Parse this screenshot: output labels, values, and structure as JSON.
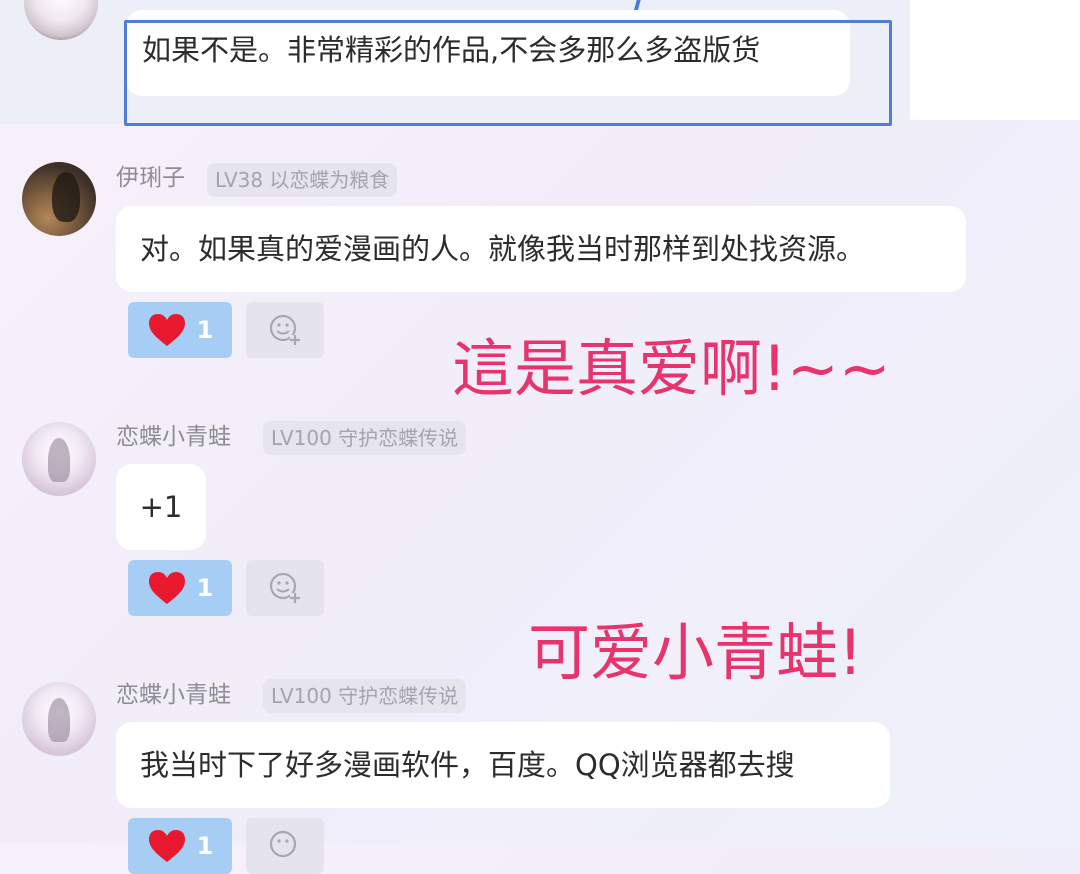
{
  "comments": [
    {
      "text": "如果不是。非常精彩的作品,不会多那么多盗版货"
    },
    {
      "username": "伊琍子",
      "level_badge": "LV38 以恋蝶为粮食",
      "text": "对。如果真的爱漫画的人。就像我当时那样到处找资源。",
      "likes": "1"
    },
    {
      "username": "恋蝶小青蛙",
      "level_badge": "LV100 守护恋蝶传说",
      "text": "+1",
      "likes": "1"
    },
    {
      "username": "恋蝶小青蛙",
      "level_badge": "LV100 守护恋蝶传说",
      "text": "我当时下了好多漫画软件，百度。QQ浏览器都去搜",
      "likes": "1"
    }
  ],
  "annotations": {
    "first": "這是真爱啊!~~",
    "second": "可爱小青蛙!"
  },
  "colors": {
    "accent_blue": "#4d7fd9",
    "like_bg": "#a6cdf3",
    "heart": "#e8192f",
    "annotation": "#e7346d"
  },
  "icons": [
    "heart-icon",
    "add-reaction-icon"
  ]
}
